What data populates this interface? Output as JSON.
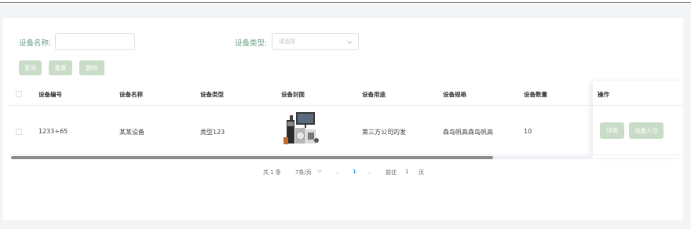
{
  "search": {
    "name_label": "设备名称:",
    "name_value": "",
    "type_label": "设备类型:",
    "type_placeholder": "请选择"
  },
  "toolbar": {
    "query": "查询",
    "reset": "重置",
    "delete": "删除"
  },
  "table": {
    "headers": [
      "设备编号",
      "设备名称",
      "设备类型",
      "设备封面",
      "设备用途",
      "设备规格",
      "设备数量",
      "操作"
    ],
    "rows": [
      {
        "code": "1233+65",
        "name": "某某设备",
        "type": "类型123",
        "cover_icon": "appliances-image",
        "usage": "第三方公司的发",
        "spec": "森岛帆高森岛帆高",
        "quantity": "10",
        "actions": [
          "详情",
          "设备入仓"
        ]
      }
    ]
  },
  "pagination": {
    "total": "共 1 条",
    "page_size": "7条/页",
    "prev": "‹",
    "current": "1",
    "next": "›",
    "goto_label": "前往",
    "goto_value": "1",
    "page_unit": "页"
  },
  "colors": {
    "label_green": "#6aa085",
    "button_green": "#c9dcc7",
    "page_blue": "#409eff"
  }
}
